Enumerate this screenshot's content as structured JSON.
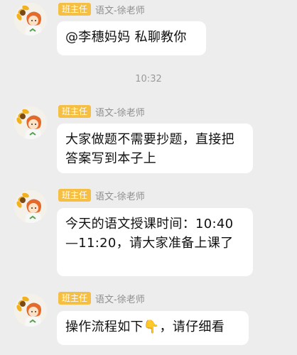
{
  "time_divider": "10:32",
  "messages": [
    {
      "badge": "班主任",
      "sender": "语文-徐老师",
      "text": "@李穗妈妈 私聊教你"
    },
    {
      "badge": "班主任",
      "sender": "语文-徐老师",
      "text": "大家做题不需要抄题，直接把答案写到本子上"
    },
    {
      "badge": "班主任",
      "sender": "语文-徐老师",
      "text": "今天的语文授课时间：10:40—11:20，请大家准备上课了"
    },
    {
      "badge": "班主任",
      "sender": "语文-徐老师",
      "text": "操作流程如下👇，请仔细看"
    }
  ],
  "icons": {
    "avatar": "sunflower-cartoon-avatar"
  },
  "colors": {
    "background": "#ededed",
    "badge": "#f5bf46",
    "bubble": "#ffffff"
  }
}
